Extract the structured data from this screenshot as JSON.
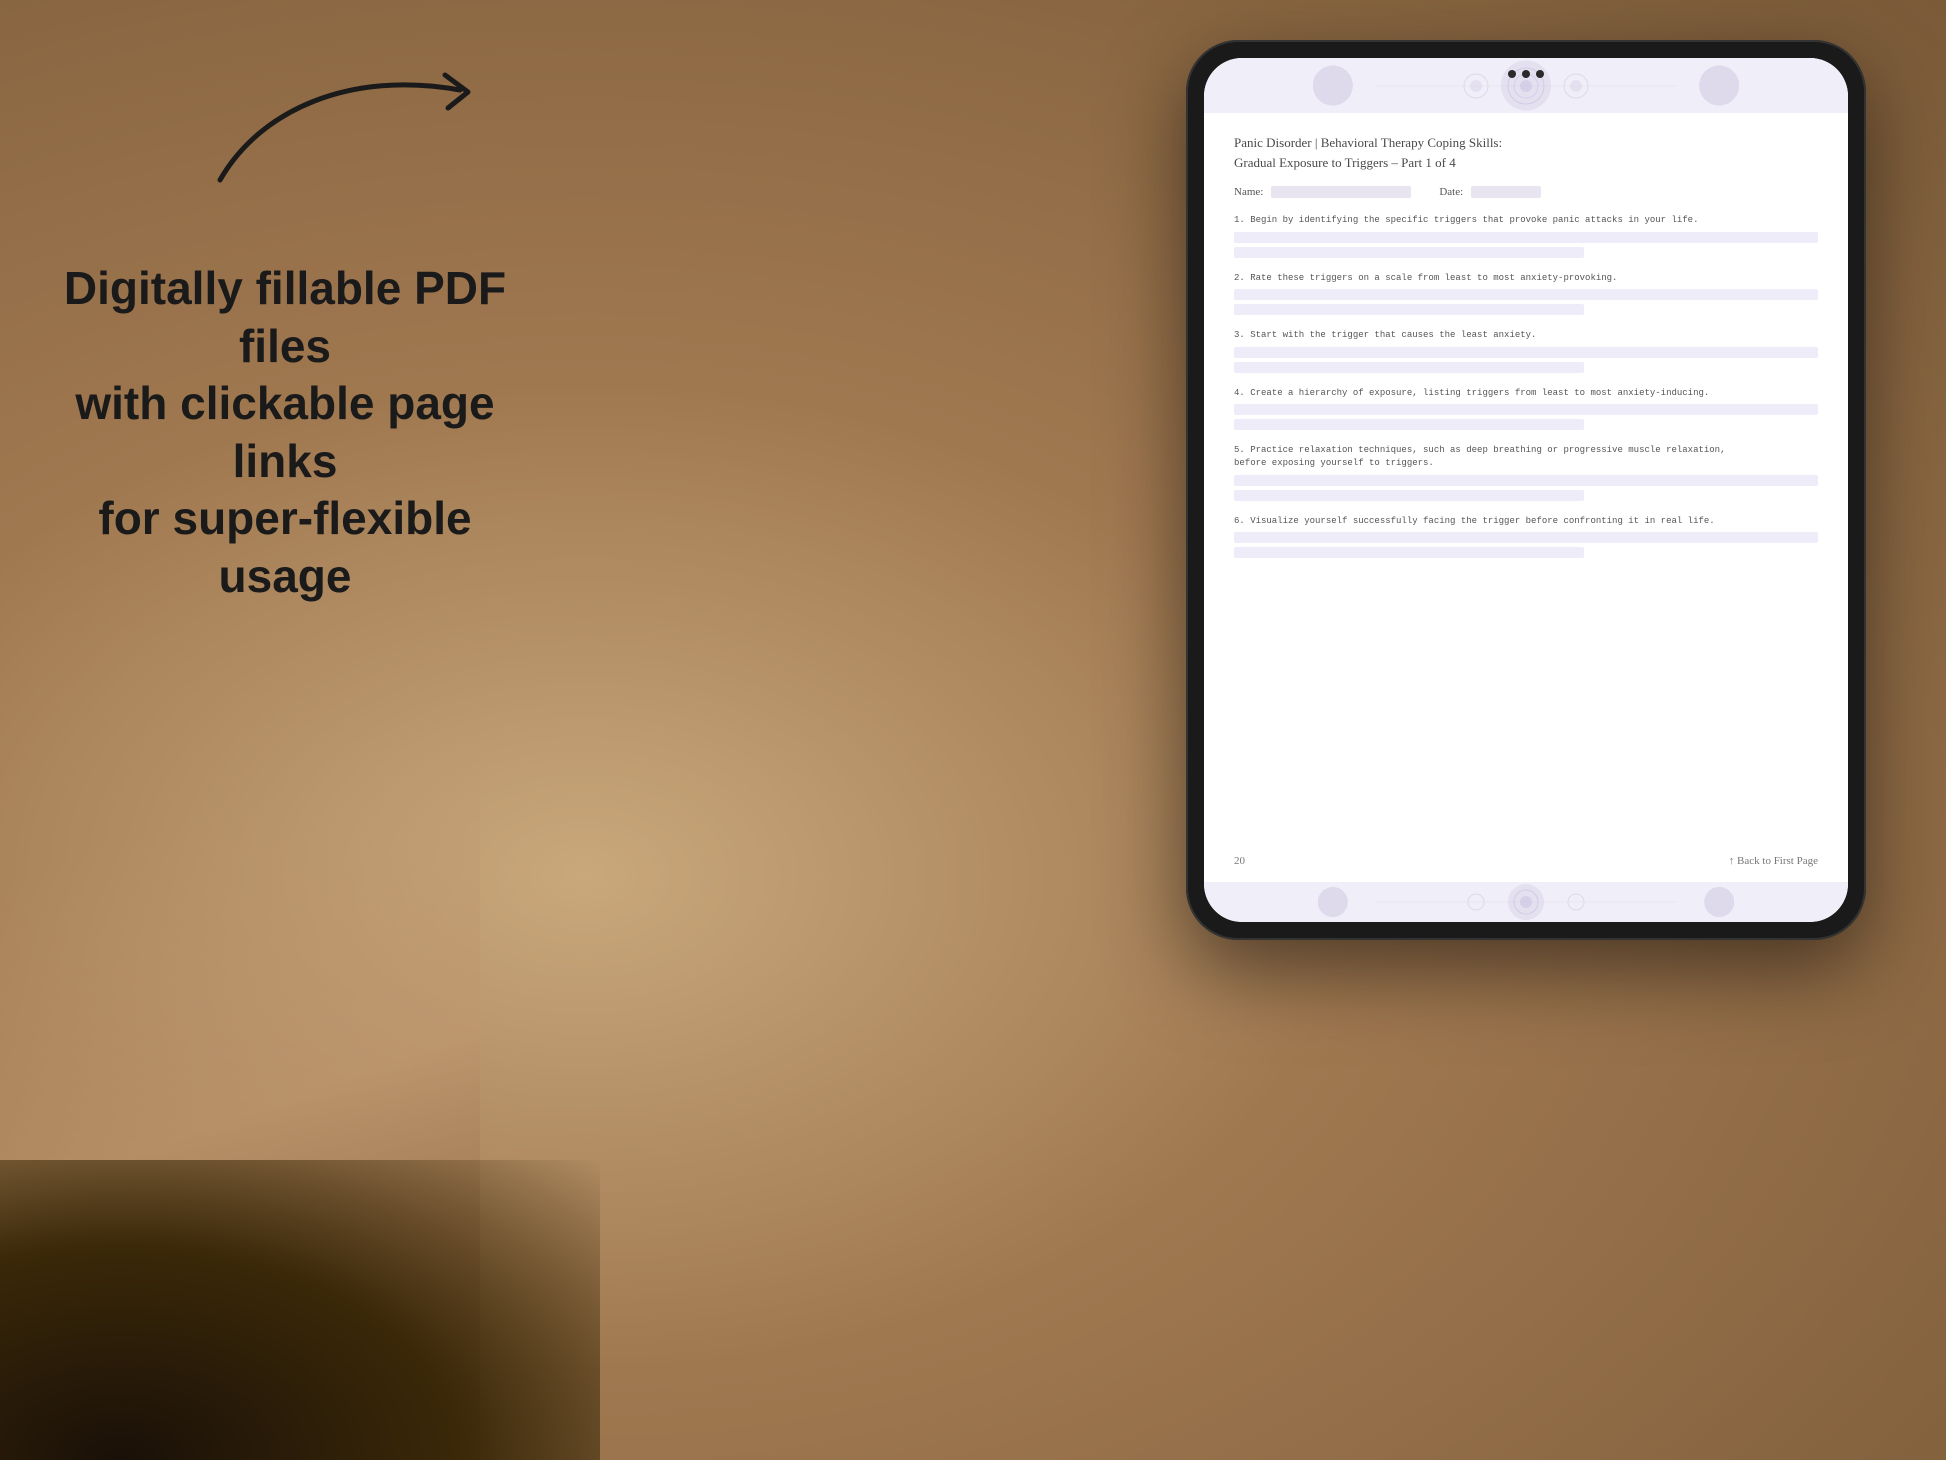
{
  "background": {
    "color": "#b5956e"
  },
  "promo": {
    "arrow_present": true,
    "line1": "Digitally fillable PDF files",
    "line2": "with clickable page links",
    "line3": "for super-flexible usage"
  },
  "tablet": {
    "camera_dots": 3
  },
  "pdf": {
    "header_deco": "mandala pattern",
    "title_line1": "Panic Disorder | Behavioral Therapy Coping Skills:",
    "title_line2": "Gradual Exposure to Triggers – Part 1 of 4",
    "name_label": "Name:",
    "date_label": "Date:",
    "instructions": [
      {
        "number": "1.",
        "text": "Begin by identifying the specific triggers that provoke panic attacks in your life.",
        "lines": 2
      },
      {
        "number": "2.",
        "text": "Rate these triggers on a scale from least to most anxiety-provoking.",
        "lines": 2
      },
      {
        "number": "3.",
        "text": "Start with the trigger that causes the least anxiety.",
        "lines": 2
      },
      {
        "number": "4.",
        "text": "Create a hierarchy of exposure, listing triggers from least to most anxiety-inducing.",
        "lines": 2
      },
      {
        "number": "5.",
        "text": "Practice relaxation techniques, such as deep breathing or progressive muscle relaxation,\nbefore exposing yourself to triggers.",
        "lines": 2
      },
      {
        "number": "6.",
        "text": "Visualize yourself successfully facing the trigger before confronting it in real life.",
        "lines": 2
      }
    ],
    "footer": {
      "page_number": "20",
      "back_link": "↑ Back to First Page"
    }
  }
}
